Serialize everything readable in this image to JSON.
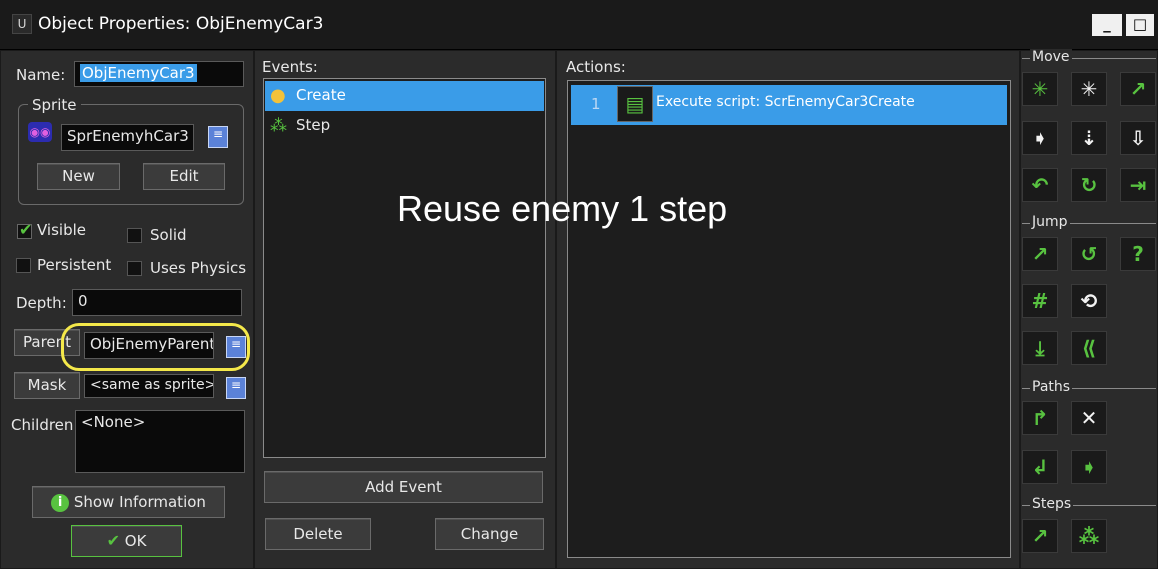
{
  "window": {
    "title": "Object Properties: ObjEnemyCar3",
    "minimize_glyph": "_",
    "maximize_glyph": "□"
  },
  "left": {
    "name_label": "Name:",
    "name_value": "ObjEnemyCar3",
    "sprite_group_label": "Sprite",
    "sprite_value": "SprEnemyhCar3",
    "new_label": "New",
    "edit_label": "Edit",
    "visible_label": "Visible",
    "visible_checked": true,
    "solid_label": "Solid",
    "persistent_label": "Persistent",
    "uses_physics_label": "Uses Physics",
    "depth_label": "Depth:",
    "depth_value": "0",
    "parent_label": "Parent",
    "parent_value": "ObjEnemyParent",
    "mask_label": "Mask",
    "mask_value": "<same as sprite>",
    "children_label": "Children:",
    "children_value": "<None>",
    "show_info_label": "Show Information",
    "ok_label": "OK"
  },
  "events": {
    "header": "Events:",
    "items": [
      {
        "label": "Create",
        "selected": true
      },
      {
        "label": "Step",
        "selected": false
      }
    ],
    "add_event_label": "Add Event",
    "delete_label": "Delete",
    "change_label": "Change"
  },
  "actions": {
    "header": "Actions:",
    "items": [
      {
        "index": "1",
        "label": "Execute script: ScrEnemyCar3Create"
      }
    ]
  },
  "overlay": {
    "annotation_text": "Reuse enemy 1 step"
  },
  "palette": {
    "sections": {
      "move": "Move",
      "jump": "Jump",
      "paths": "Paths",
      "steps": "Steps"
    }
  },
  "colors": {
    "selection": "#3a9ce8",
    "highlight": "#f4e84a",
    "icon_green": "#58c240"
  }
}
